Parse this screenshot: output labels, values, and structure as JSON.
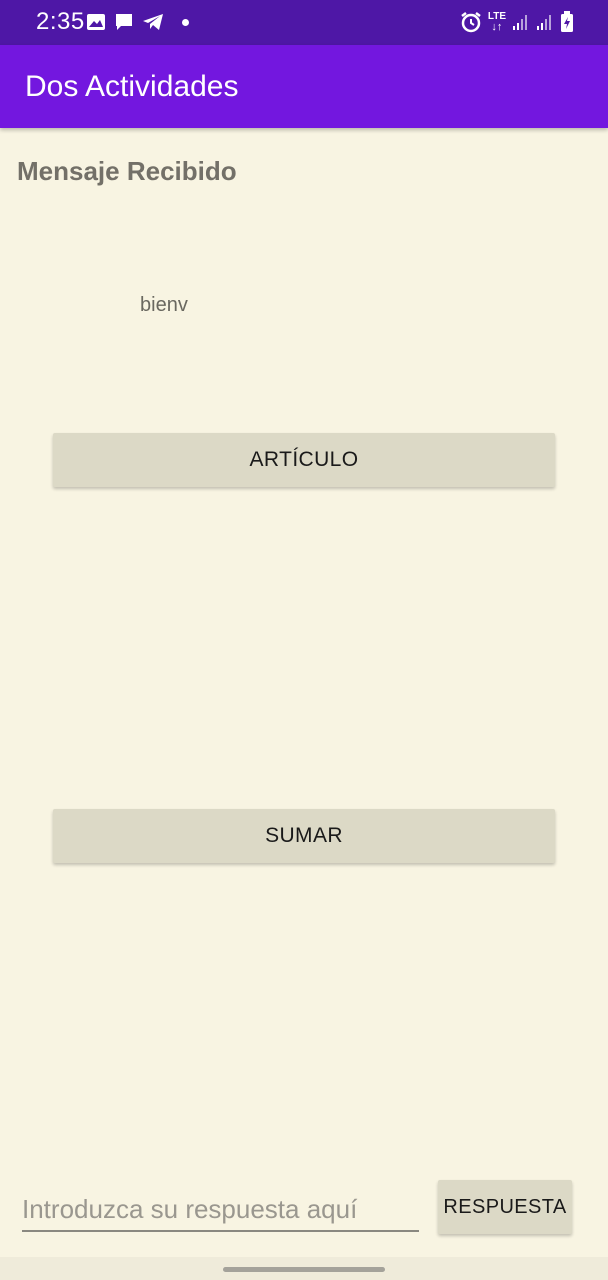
{
  "status_bar": {
    "time": "2:35",
    "left_icons": [
      "image-icon",
      "message-icon",
      "telegram-icon",
      "notification-dot-icon"
    ],
    "right_icons": [
      "alarm-icon",
      "lte-icon",
      "signal-icon",
      "signal-icon",
      "battery-charging-icon"
    ],
    "lte_label": "LTE"
  },
  "app_bar": {
    "title": "Dos Actividades"
  },
  "main": {
    "received_label": "Mensaje Recibido",
    "message": "bienv",
    "articulo_button": "ARTÍCULO",
    "sumar_button": "SUMAR"
  },
  "reply": {
    "placeholder": "Introduzca su respuesta aquí",
    "value": "",
    "button": "RESPUESTA"
  },
  "colors": {
    "status_bar": "#4e17a6",
    "app_bar": "#7317df",
    "background": "#f8f4e2",
    "button": "#dcd9c6"
  }
}
